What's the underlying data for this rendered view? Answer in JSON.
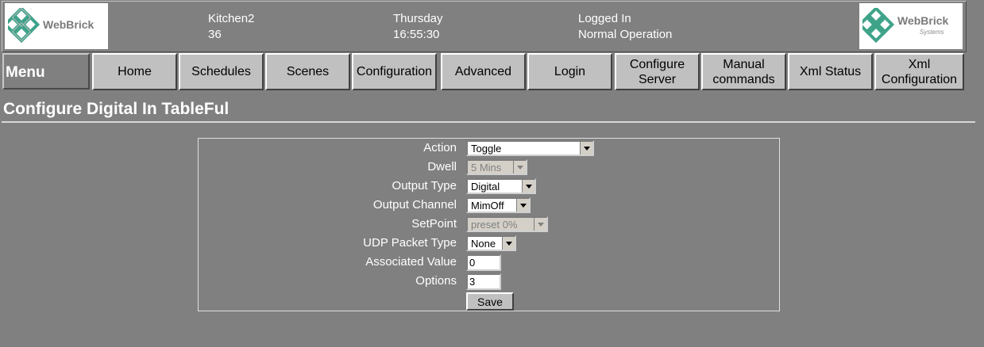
{
  "header": {
    "logo_left": "WebBrick",
    "logo_right": "WebBrick",
    "logo_right_sub": "Systems",
    "node_name": "Kitchen2",
    "node_number": "36",
    "day": "Thursday",
    "time": "16:55:30",
    "login_status": "Logged In",
    "operation_status": "Normal Operation"
  },
  "nav": {
    "menu_label": "Menu",
    "items": [
      {
        "label": "Home"
      },
      {
        "label": "Schedules"
      },
      {
        "label": "Scenes"
      },
      {
        "label": "Configuration"
      },
      {
        "label": "Advanced"
      },
      {
        "label": "Login"
      },
      {
        "label": "Configure Server"
      },
      {
        "label": "Manual commands"
      },
      {
        "label": "Xml Status"
      },
      {
        "label": "Xml Configuration"
      }
    ]
  },
  "page": {
    "title": "Configure Digital In TableFul"
  },
  "form": {
    "action": {
      "label": "Action",
      "value": "Toggle"
    },
    "dwell": {
      "label": "Dwell",
      "value": "5 Mins"
    },
    "output_type": {
      "label": "Output Type",
      "value": "Digital"
    },
    "output_channel": {
      "label": "Output Channel",
      "value": "MimOff"
    },
    "setpoint": {
      "label": "SetPoint",
      "value": "preset 0%"
    },
    "udp_packet_type": {
      "label": "UDP Packet Type",
      "value": "None"
    },
    "associated_value": {
      "label": "Associated Value",
      "value": "0"
    },
    "options": {
      "label": "Options",
      "value": "3"
    },
    "save_label": "Save"
  },
  "colors": {
    "background": "#808080",
    "button_face": "#c0c0c0",
    "logo_accent": "#3fa38a"
  }
}
